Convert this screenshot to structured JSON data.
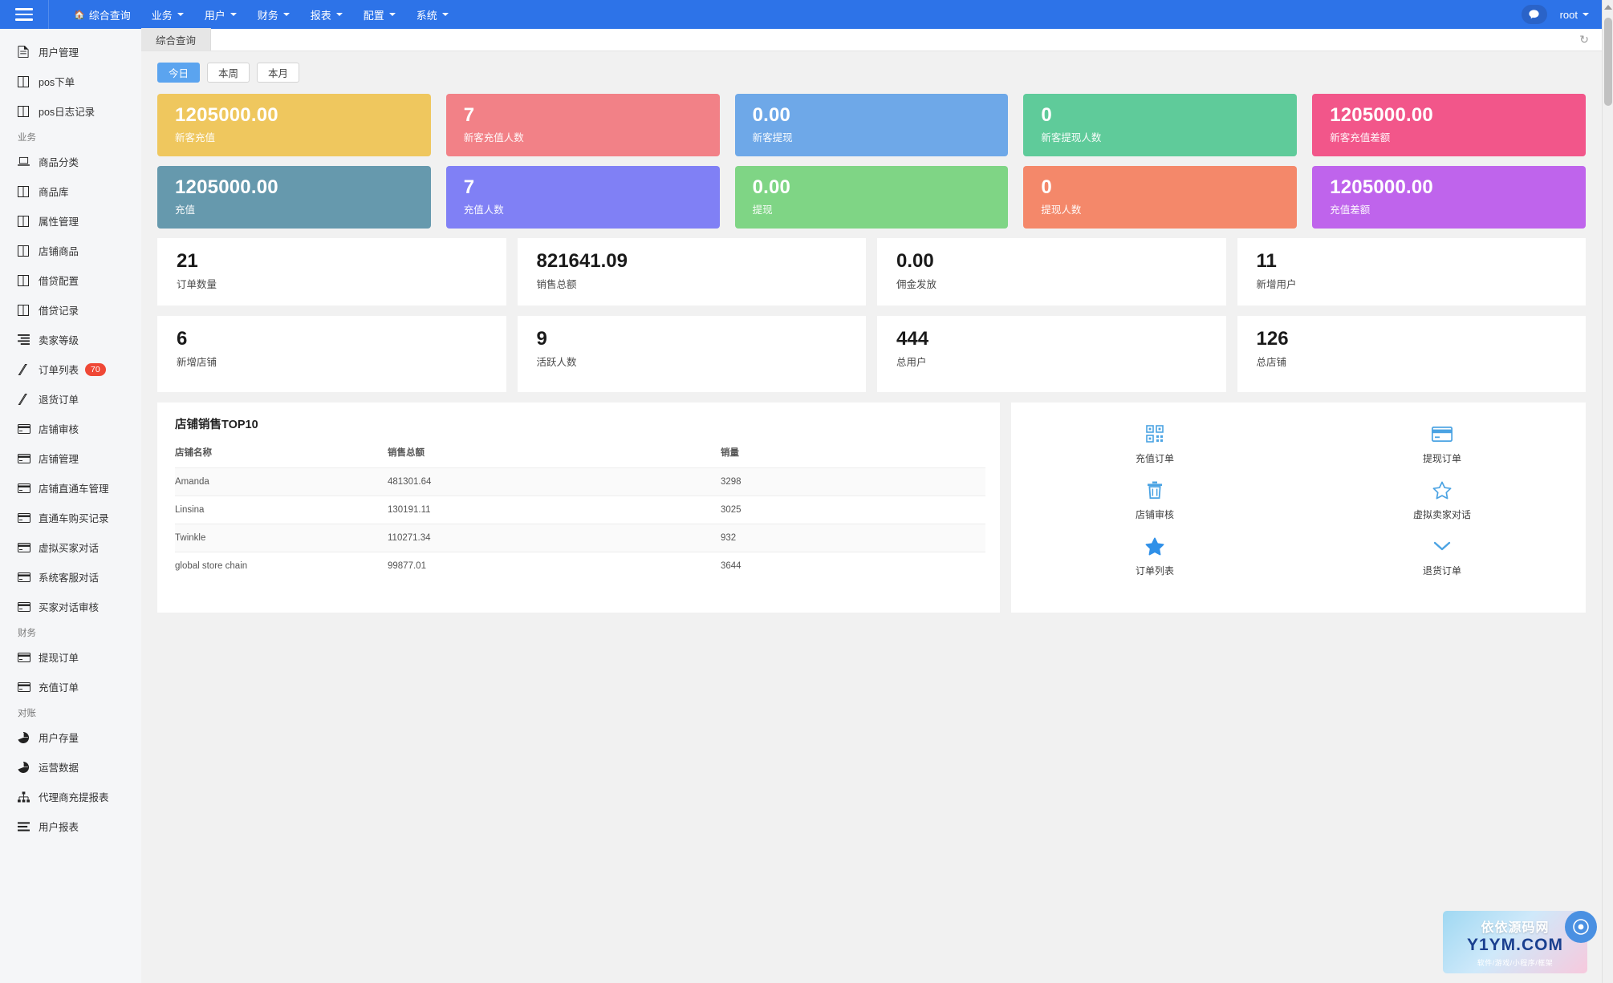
{
  "header": {
    "menu_icon": "hamburger-icon",
    "nav": [
      {
        "label": "综合查询",
        "icon": "home-icon",
        "has_caret": false
      },
      {
        "label": "业务",
        "has_caret": true
      },
      {
        "label": "用户",
        "has_caret": true
      },
      {
        "label": "财务",
        "has_caret": true
      },
      {
        "label": "报表",
        "has_caret": true
      },
      {
        "label": "配置",
        "has_caret": true
      },
      {
        "label": "系统",
        "has_caret": true
      }
    ],
    "chat_icon": "chat-bubble-icon",
    "user": "root",
    "accent": "#2d73e8"
  },
  "sidebar": {
    "items": [
      {
        "label": "用户管理",
        "icon": "file-text-icon"
      },
      {
        "label": "pos下单",
        "icon": "columns-icon"
      },
      {
        "label": "pos日志记录",
        "icon": "columns-icon"
      },
      {
        "group": "业务"
      },
      {
        "label": "商品分类",
        "icon": "laptop-icon"
      },
      {
        "label": "商品库",
        "icon": "columns-icon"
      },
      {
        "label": "属性管理",
        "icon": "columns-icon"
      },
      {
        "label": "店铺商品",
        "icon": "columns-icon"
      },
      {
        "label": "借贷配置",
        "icon": "columns-icon"
      },
      {
        "label": "借贷记录",
        "icon": "columns-icon"
      },
      {
        "label": "卖家等级",
        "icon": "list-icon"
      },
      {
        "label": "订单列表",
        "icon": "tag-icon",
        "badge": "70"
      },
      {
        "label": "退货订单",
        "icon": "tag-icon"
      },
      {
        "label": "店铺审核",
        "icon": "credit-card-icon"
      },
      {
        "label": "店铺管理",
        "icon": "credit-card-icon"
      },
      {
        "label": "店铺直通车管理",
        "icon": "credit-card-icon"
      },
      {
        "label": "直通车购买记录",
        "icon": "credit-card-icon"
      },
      {
        "label": "虚拟买家对话",
        "icon": "credit-card-icon"
      },
      {
        "label": "系统客服对话",
        "icon": "credit-card-icon"
      },
      {
        "label": "买家对话审核",
        "icon": "credit-card-icon"
      },
      {
        "group": "财务"
      },
      {
        "label": "提现订单",
        "icon": "credit-card-icon"
      },
      {
        "label": "充值订单",
        "icon": "credit-card-icon"
      },
      {
        "group": "对账"
      },
      {
        "label": "用户存量",
        "icon": "pie-chart-icon"
      },
      {
        "label": "运营数据",
        "icon": "pie-chart-icon"
      },
      {
        "label": "代理商充提报表",
        "icon": "sitemap-icon"
      },
      {
        "label": "用户报表",
        "icon": "bars-icon"
      }
    ]
  },
  "tabs": [
    {
      "label": "综合查询",
      "active": true
    }
  ],
  "refresh_icon": "refresh-icon",
  "filters": {
    "buttons": [
      {
        "label": "今日",
        "active": true
      },
      {
        "label": "本周",
        "active": false
      },
      {
        "label": "本月",
        "active": false
      }
    ]
  },
  "tiles": [
    [
      {
        "value": "1205000.00",
        "label": "新客充值",
        "color": "#efc75e"
      },
      {
        "value": "7",
        "label": "新客充值人数",
        "color": "#f28187"
      },
      {
        "value": "0.00",
        "label": "新客提现",
        "color": "#6ea8e8"
      },
      {
        "value": "0",
        "label": "新客提现人数",
        "color": "#5fcb9a"
      },
      {
        "value": "1205000.00",
        "label": "新客充值差额",
        "color": "#f2568a"
      }
    ],
    [
      {
        "value": "1205000.00",
        "label": "充值",
        "color": "#6699ad"
      },
      {
        "value": "7",
        "label": "充值人数",
        "color": "#8080f5"
      },
      {
        "value": "0.00",
        "label": "提现",
        "color": "#7fd585"
      },
      {
        "value": "0",
        "label": "提现人数",
        "color": "#f4886a"
      },
      {
        "value": "1205000.00",
        "label": "充值差额",
        "color": "#bf64ec"
      }
    ]
  ],
  "stats": [
    [
      {
        "value": "21",
        "label": "订单数量"
      },
      {
        "value": "821641.09",
        "label": "销售总额"
      },
      {
        "value": "0.00",
        "label": "佣金发放"
      },
      {
        "value": "11",
        "label": "新增用户"
      }
    ],
    [
      {
        "value": "6",
        "label": "新增店铺"
      },
      {
        "value": "9",
        "label": "活跃人数"
      },
      {
        "value": "444",
        "label": "总用户"
      },
      {
        "value": "126",
        "label": "总店铺"
      }
    ]
  ],
  "top_table": {
    "title": "店铺销售TOP10",
    "columns": [
      "店铺名称",
      "销售总额",
      "销量"
    ],
    "rows": [
      [
        "Amanda",
        "481301.64",
        "3298"
      ],
      [
        "Linsina",
        "130191.11",
        "3025"
      ],
      [
        "Twinkle",
        "110271.34",
        "932"
      ],
      [
        "global store chain",
        "99877.01",
        "3644"
      ]
    ]
  },
  "quick_actions": [
    {
      "label": "充值订单",
      "icon": "qrcode-icon"
    },
    {
      "label": "提现订单",
      "icon": "credit-card-icon"
    },
    {
      "label": "店铺审核",
      "icon": "trash-icon"
    },
    {
      "label": "虚拟卖家对话",
      "icon": "star-outline-icon"
    },
    {
      "label": "订单列表",
      "icon": "star-filled-icon"
    },
    {
      "label": "退货订单",
      "icon": "chevron-down-icon"
    }
  ],
  "watermark": {
    "line1": "依依源码网",
    "line2": "Y1YM.COM",
    "line3": "软件/游戏/小程序/框架"
  }
}
